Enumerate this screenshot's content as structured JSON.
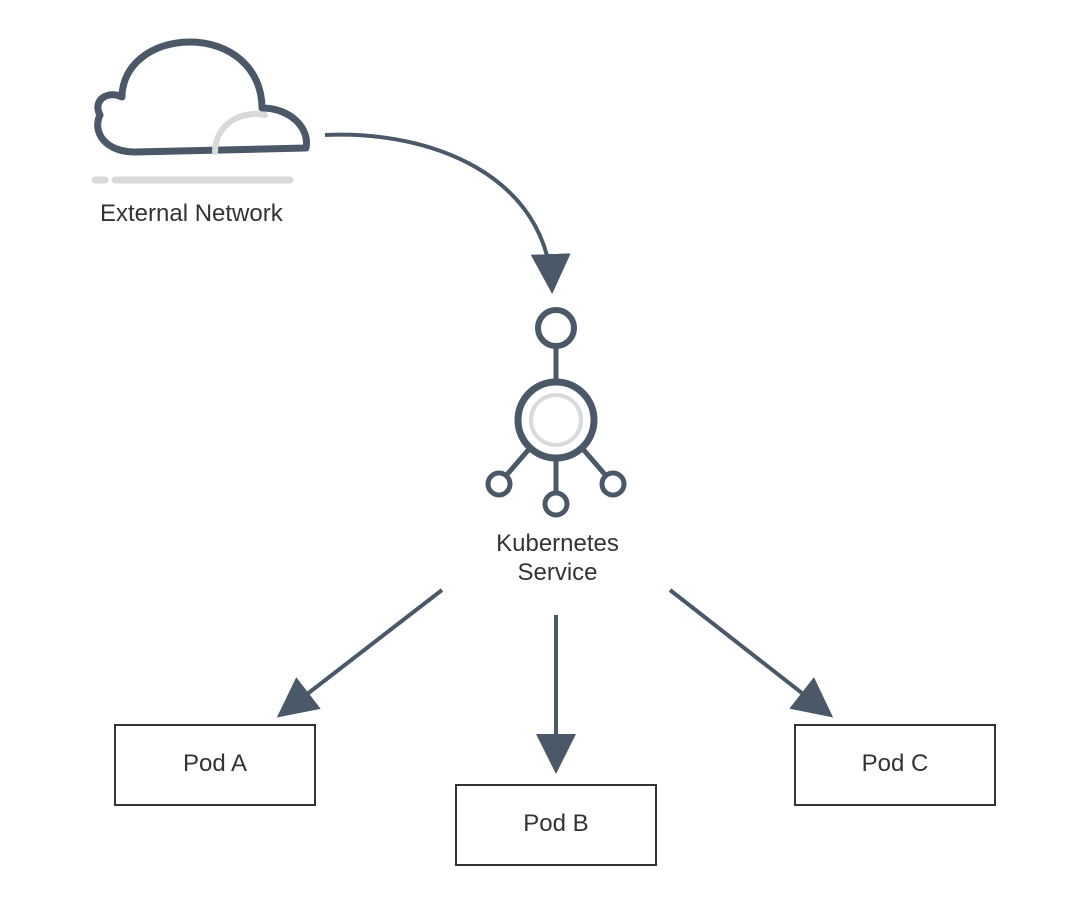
{
  "nodes": {
    "externalNetwork": {
      "label": "External Network"
    },
    "kubernetesService": {
      "label_line1": "Kubernetes",
      "label_line2": "Service"
    },
    "podA": {
      "label": "Pod A"
    },
    "podB": {
      "label": "Pod B"
    },
    "podC": {
      "label": "Pod C"
    }
  },
  "colors": {
    "stroke": "#4a5868",
    "lightStroke": "#d8d9db",
    "fill": "#ffffff",
    "text": "#333333"
  }
}
